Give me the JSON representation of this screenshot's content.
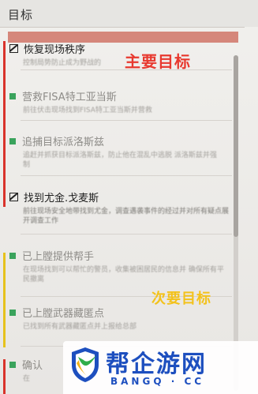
{
  "header": {
    "title": "目标"
  },
  "annotations": {
    "main": "主要目标",
    "secondary": "次要目标"
  },
  "objectives": [
    {
      "title": "恢复现场秩序",
      "desc": "控制局势防止成为野战的",
      "icon": "checkbox-icon",
      "faded": false
    },
    {
      "title": "营救FISA特工亚当斯",
      "desc": "前往伏击现场找到FISA特工亚当斯并营救",
      "icon": "green-square-icon",
      "faded": true
    },
    {
      "title": "追捕目标派洛斯兹",
      "desc": "追赶并抓获目标派洛斯兹，防止他在混乱中逃脱 派洛斯兹并强制",
      "icon": "green-square-icon",
      "faded": true
    },
    {
      "title": "找到尤金.戈麦斯",
      "desc": "前往现场安全地带找到尤金，调查遇袭事件的经过并对所有疑点展开调查工作",
      "icon": "checkbox-icon",
      "faded": false
    },
    {
      "title": "已上膛提供帮手",
      "desc": "在现场找到可以帮忙的警员，收集被困居民的信息并 确保所有平民撤离",
      "icon": "green-square-icon",
      "faded": true
    },
    {
      "title": "已上膛武器藏匿点",
      "desc": "已找到所有武器藏匿点并上报给总部",
      "icon": "green-square-icon",
      "faded": true
    },
    {
      "title": "确认",
      "desc": "在",
      "icon": "green-square-icon",
      "faded": true
    }
  ],
  "watermark": {
    "name": "帮企游网",
    "domain": "BANGQ · CC"
  },
  "colors": {
    "main_annotation": "#e8392f",
    "secondary_annotation": "#f3c21b",
    "completed_square": "#3aa35c",
    "selected_highlight": "#d27b6f",
    "watermark_blue": "#1d4fbf"
  }
}
